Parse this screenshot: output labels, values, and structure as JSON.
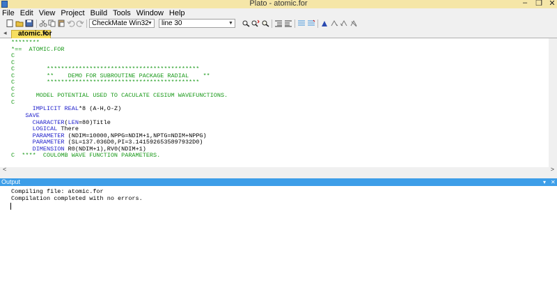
{
  "window": {
    "title": "Plato - atomic.for"
  },
  "menu": [
    "File",
    "Edit",
    "View",
    "Project",
    "Build",
    "Tools",
    "Window",
    "Help"
  ],
  "toolbar": {
    "target_combo": "CheckMate Win32",
    "line_combo": "line 30"
  },
  "tabs": [
    {
      "label": "atomic.for"
    }
  ],
  "editor": {
    "lines": [
      {
        "text": "********",
        "kind": "comment"
      },
      {
        "text": "*==  ATOMIC.FOR",
        "kind": "comment"
      },
      {
        "text": "C",
        "kind": "comment"
      },
      {
        "text": "C",
        "kind": "comment"
      },
      {
        "text": "C         *******************************************",
        "kind": "comment"
      },
      {
        "text": "C         **    DEMO FOR SUBROUTINE PACKAGE RADIAL    **",
        "kind": "comment"
      },
      {
        "text": "C         *******************************************",
        "kind": "comment"
      },
      {
        "text": "C",
        "kind": "comment"
      },
      {
        "text": "C      MODEL POTENTIAL USED TO CACULATE CESIUM WAVEFUNCTIONS.",
        "kind": "comment"
      },
      {
        "text": "C",
        "kind": "comment"
      },
      {
        "text": "      IMPLICIT REAL*8 (A-H,O-Z)",
        "kind": "code"
      },
      {
        "text": "    SAVE",
        "kind": "code"
      },
      {
        "text": "      CHARACTER(LEN=80)Title",
        "kind": "code"
      },
      {
        "text": "      LOGICAL There",
        "kind": "code"
      },
      {
        "text": "      PARAMETER (NDIM=10000,NPPG=NDIM+1,NPTG=NDIM+NPPG)",
        "kind": "code"
      },
      {
        "text": "      PARAMETER (SL=137.036D0,PI=3.1415926535897932D0)",
        "kind": "code"
      },
      {
        "text": "      DIMENSION R0(NDIM+1),RV0(NDIM+1)",
        "kind": "code"
      },
      {
        "text": "C  ****  COULOMB WAVE FUNCTION PARAMETERS.",
        "kind": "comment"
      }
    ]
  },
  "output": {
    "title": "Output",
    "lines": [
      "Compiling file: atomic.for",
      "Compilation completed with no errors."
    ]
  },
  "colors": {
    "comment": "#1a9a1a",
    "keyword": "#2222cc",
    "output_header": "#3d9ee8",
    "title_bar": "#f5e6a8"
  }
}
